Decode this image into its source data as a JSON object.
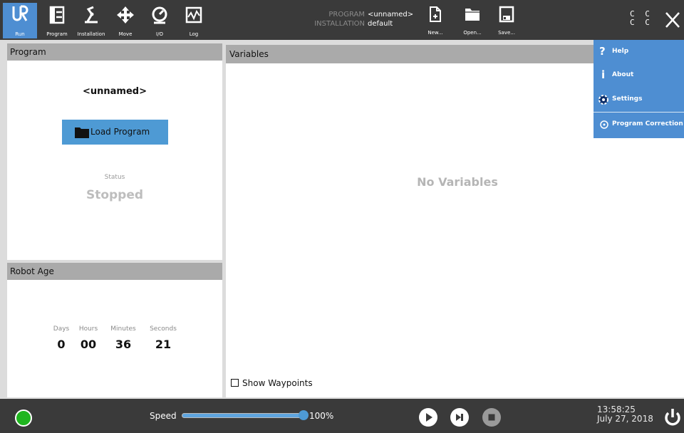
{
  "topbar": {
    "nav": [
      {
        "label": "Run",
        "icon": "ur-logo-icon"
      },
      {
        "label": "Program",
        "icon": "program-tree-icon"
      },
      {
        "label": "Installation",
        "icon": "robot-arm-icon"
      },
      {
        "label": "Move",
        "icon": "move-arrows-icon"
      },
      {
        "label": "I/O",
        "icon": "io-gauge-icon"
      },
      {
        "label": "Log",
        "icon": "log-chart-icon"
      }
    ],
    "program_key": "PROGRAM",
    "program_value": "<unnamed>",
    "installation_key": "INSTALLATION",
    "installation_value": "default",
    "file_buttons": [
      {
        "label": "New...",
        "icon": "new-file-icon"
      },
      {
        "label": "Open...",
        "icon": "open-folder-icon"
      },
      {
        "label": "Save...",
        "icon": "save-disk-icon"
      }
    ],
    "mode_indicator_line1": "C C",
    "mode_indicator_line2": "C C"
  },
  "program_panel": {
    "title": "Program",
    "program_name": "<unnamed>",
    "load_button": "Load Program",
    "status_label": "Status",
    "status_value": "Stopped"
  },
  "robot_age": {
    "title": "Robot Age",
    "units": [
      "Days",
      "Hours",
      "Minutes",
      "Seconds"
    ],
    "values": [
      "0",
      "00",
      "36",
      "21"
    ]
  },
  "variables_panel": {
    "title": "Variables",
    "empty_text": "No Variables",
    "show_waypoints_label": "Show Waypoints",
    "show_waypoints_checked": false
  },
  "menu": {
    "items": [
      {
        "label": "Help",
        "icon": "?"
      },
      {
        "label": "About",
        "icon": "i"
      },
      {
        "label": "Settings",
        "icon": "gear"
      },
      {
        "label": "Program Correction",
        "icon": "target"
      }
    ]
  },
  "bottombar": {
    "speed_label": "Speed",
    "speed_value": "100%",
    "speed_percent": 100,
    "time": "13:58:25",
    "date": "July 27, 2018"
  },
  "colors": {
    "bar_bg": "#3a3a3a",
    "accent_blue": "#4e8ed2",
    "status_green": "#1fb51f"
  }
}
